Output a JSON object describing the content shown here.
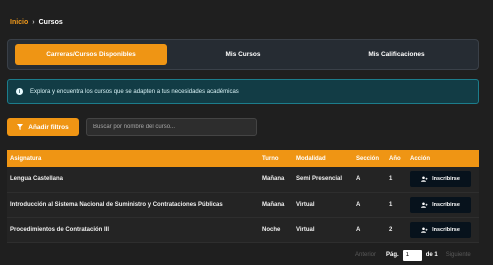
{
  "breadcrumb": {
    "home": "Inicio",
    "separator": "›",
    "current": "Cursos"
  },
  "tabs": [
    {
      "label": "Carreras/Cursos Disponibles",
      "active": true
    },
    {
      "label": "Mis Cursos",
      "active": false
    },
    {
      "label": "Mis Calificaciones",
      "active": false
    }
  ],
  "info": {
    "icon": "info-icon",
    "text": "Explora y encuentra los cursos que se adapten a tus necesidades académicas"
  },
  "toolbar": {
    "filter_label": "Añadir filtros",
    "search_placeholder": "Buscar por nombre del curso..."
  },
  "table": {
    "headers": [
      "Asignatura",
      "Turno",
      "Modalidad",
      "Sección",
      "Año",
      "Acción"
    ],
    "rows": [
      {
        "asignatura": "Lengua Castellana",
        "turno": "Mañana",
        "modalidad": "Semi Presencial",
        "seccion": "A",
        "anio": "1",
        "accion": "Inscribirse"
      },
      {
        "asignatura": "Introducción al Sistema Nacional de Suministro y Contrataciones Públicas",
        "turno": "Mañana",
        "modalidad": "Virtual",
        "seccion": "A",
        "anio": "1",
        "accion": "Inscribirse"
      },
      {
        "asignatura": "Procedimientos de Contratación III",
        "turno": "Noche",
        "modalidad": "Virtual",
        "seccion": "A",
        "anio": "2",
        "accion": "Inscribirse"
      }
    ]
  },
  "pagination": {
    "prev": "Anterior",
    "page_label": "Pág.",
    "page_value": "1",
    "of_label": "de 1",
    "next": "Siguiente"
  },
  "colors": {
    "accent": "#ef9514",
    "background": "#1f1f1f",
    "info_bg": "#123c45",
    "button_dark": "#07121c"
  }
}
